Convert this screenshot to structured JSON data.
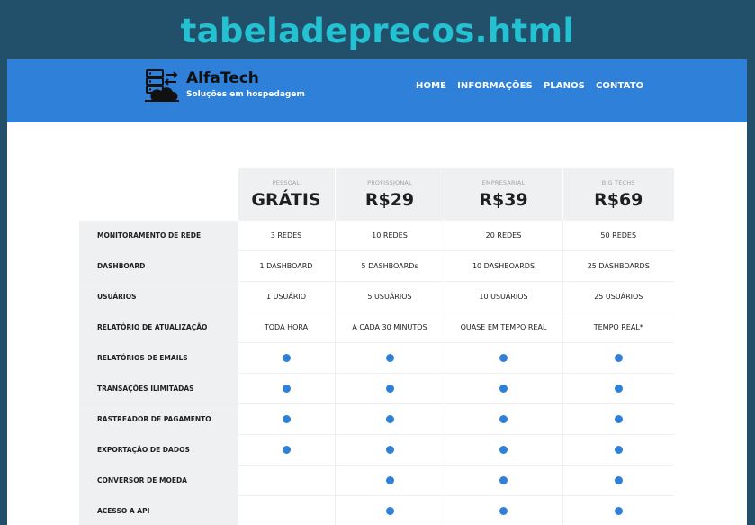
{
  "page_title": "tabeladeprecos.html",
  "brand": {
    "name": "AlfaTech",
    "tagline": "Soluções em hospedagem",
    "logo_icon": "server-cloud-icon"
  },
  "nav": [
    "HOME",
    "INFORMAÇÕES",
    "PLANOS",
    "CONTATO"
  ],
  "colors": {
    "background": "#22506a",
    "title": "#23c1d1",
    "header": "#2e80d9",
    "check_dot": "#2e80d9"
  },
  "plans": [
    {
      "name": "PESSOAL",
      "price": "GRÁTIS"
    },
    {
      "name": "PROFISSIONAL",
      "price": "R$29"
    },
    {
      "name": "EMPRESARIAL",
      "price": "R$39"
    },
    {
      "name": "BIG TECHS",
      "price": "R$69"
    }
  ],
  "features": [
    {
      "label": "MONITORAMENTO DE REDE",
      "values": [
        "3 REDES",
        "10 REDES",
        "20 REDES",
        "50 REDES"
      ]
    },
    {
      "label": "DASHBOARD",
      "values": [
        "1 DASHBOARD",
        "5 DASHBOARDs",
        "10 DASHBOARDS",
        "25 DASHBOARDS"
      ]
    },
    {
      "label": "USUÁRIOS",
      "values": [
        "1 USUÁRIO",
        "5 USUÁRIOS",
        "10 USUÁRIOS",
        "25 USUÁRIOS"
      ]
    },
    {
      "label": "RELATÓRIO DE ATUALIZAÇÃO",
      "values": [
        "TODA HORA",
        "A CADA 30 MINUTOS",
        "QUASE EM TEMPO REAL",
        "TEMPO REAL*"
      ]
    },
    {
      "label": "RELATÓRIOS DE EMAILS",
      "values": [
        true,
        true,
        true,
        true
      ]
    },
    {
      "label": "TRANSAÇÕES ILIMITADAS",
      "values": [
        true,
        true,
        true,
        true
      ]
    },
    {
      "label": "RASTREADOR DE PAGAMENTO",
      "values": [
        true,
        true,
        true,
        true
      ]
    },
    {
      "label": "EXPORTAÇÃO DE DADOS",
      "values": [
        true,
        true,
        true,
        true
      ]
    },
    {
      "label": "CONVERSOR DE MOEDA",
      "values": [
        false,
        true,
        true,
        true
      ]
    },
    {
      "label": "ACESSO A API",
      "values": [
        false,
        true,
        true,
        true
      ]
    }
  ]
}
